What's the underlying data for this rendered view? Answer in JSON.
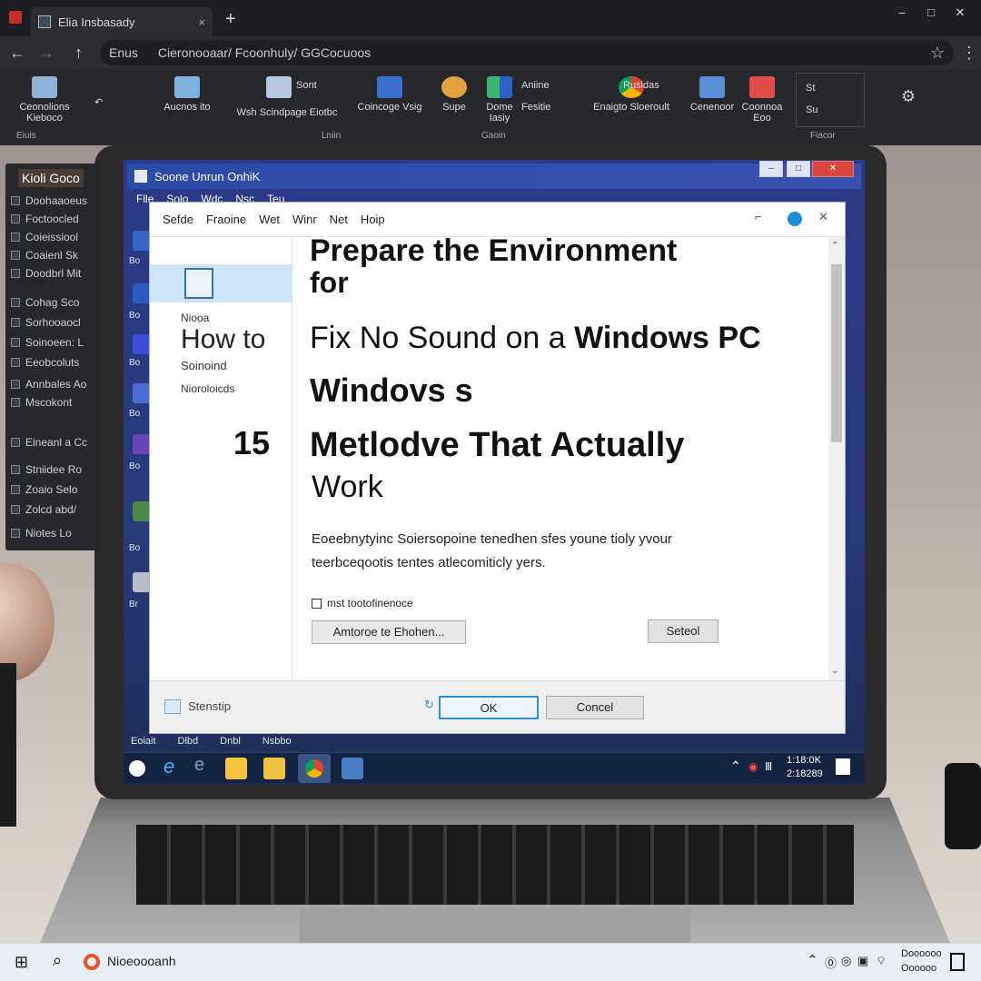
{
  "browser": {
    "tab_title": "Elia Insbasady",
    "tab_close": "×",
    "new_tab": "+",
    "window_buttons": [
      "–",
      "□",
      "✕"
    ],
    "url_prefix": "Enus",
    "url": "Cieronooaar/ Fcoonhuly/ GGCocuoos"
  },
  "ribbon": {
    "items": [
      {
        "label": "Ceonolions Kieboco",
        "sub": "∨"
      },
      {
        "label": "Aucnos ito"
      },
      {
        "label": "Wsh  Scindpage  Eiotbc"
      },
      {
        "label": "Coincoge Vsig"
      },
      {
        "label": "Supe"
      },
      {
        "label": "Dome Iasiy"
      },
      {
        "label": "Aniine",
        "sub": "Fesitie"
      },
      {
        "label": "Enaigto Sloeroult"
      },
      {
        "label": "Rusidas"
      },
      {
        "label": "Cenenoor"
      },
      {
        "label": "Coonnoa Eoo"
      },
      {
        "label": "St",
        "sub": "Su"
      }
    ],
    "groups": [
      "Eiuis",
      "Lniin",
      "Gaoin",
      "Fiacor"
    ],
    "sort_label": "Sont"
  },
  "left_panel": {
    "header": "Kioli Goco",
    "items": [
      "Doohaaoeus",
      "Foctoocled",
      "Coieissiool",
      "Coaienl Sk",
      "Doodbrl Mit",
      "Cohag Sco",
      "Sorhooaocl",
      "Soinoeen: L",
      "Eeobcoluts",
      "Annbales Ao",
      "Mscokont",
      "Eineanl a Cc",
      "Stniidee Ro",
      "Zoaio Selo",
      "Zolcd abd/",
      "Niotes Lo"
    ]
  },
  "inner_window": {
    "title": "Soone Unrun OnhiK",
    "menu": [
      "Flle",
      "Solo",
      "Wdc",
      "Nsc",
      "Teu"
    ],
    "desktop_labels": [
      "Bo",
      "Bo",
      "Bo",
      "Bo",
      "Bo",
      "Bo",
      "Br",
      "Beo"
    ]
  },
  "dialog": {
    "menu": [
      "Sefde",
      "Fraoine",
      "Wet",
      "Winr",
      "Net",
      "Hoip"
    ],
    "sidebar_label1": "Niooa",
    "sidebar_how": "How to",
    "sidebar_label2": "Soinoind",
    "sidebar_label3": "Nioroloicds",
    "number": "15",
    "heading1": "Prepare the Environment",
    "heading1b": "for",
    "heading2_light": "Fix No Sound on a ",
    "heading2_bold": "Windows PC",
    "heading3": "Windovs s",
    "heading4": "Metlodve That Actually",
    "heading4b": "Work",
    "desc1": "Eoeebnytyinc Soiersopoine tenedhen sfes youne tioly yvour",
    "desc2": "teerbceqootis tentes atlecomiticly yers.",
    "checkbox": "mst tootofinenoce",
    "button_left": "Amtoroe te Ehohen...",
    "button_right": "Seteol",
    "footer_label": "Stenstip",
    "ok": "OK",
    "cancel": "Concel",
    "bottom_tabs": [
      "Eoiait",
      "Dlbd",
      "Dnbl",
      "Nsbbo"
    ]
  },
  "inner_taskbar": {
    "clock1": "1:18:0K",
    "clock2": "2:18289"
  },
  "taskbar": {
    "search_text": "Nioeoooanh",
    "clock1": "Doooooo",
    "clock2": "Oooooo"
  }
}
